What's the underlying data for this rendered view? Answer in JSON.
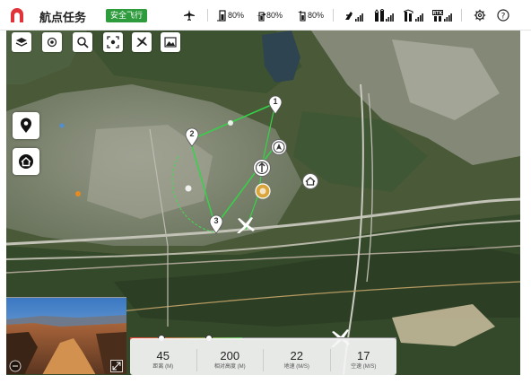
{
  "header": {
    "app_title": "航点任务",
    "status_badge": "安全飞行",
    "battery_1": "80%",
    "battery_2": "80%",
    "battery_3": "80%",
    "colors": {
      "status": "#2e9b3c",
      "logo": "#e0333a"
    }
  },
  "map": {
    "waypoints": [
      {
        "label": "1"
      },
      {
        "label": "2"
      },
      {
        "label": "3"
      }
    ],
    "tools": [
      "layers-icon",
      "locate-icon",
      "search-icon",
      "focus-icon",
      "aircraft-icon",
      "photo-icon"
    ],
    "side_buttons": [
      "location-pin-icon",
      "home-icon"
    ]
  },
  "telemetry": {
    "progress": 0.42,
    "items": [
      {
        "value": "45",
        "label": "距离 (M)"
      },
      {
        "value": "200",
        "label": "相对高度 (M)"
      },
      {
        "value": "22",
        "label": "地速 (M/S)"
      },
      {
        "value": "17",
        "label": "空速 (M/S)"
      }
    ]
  }
}
